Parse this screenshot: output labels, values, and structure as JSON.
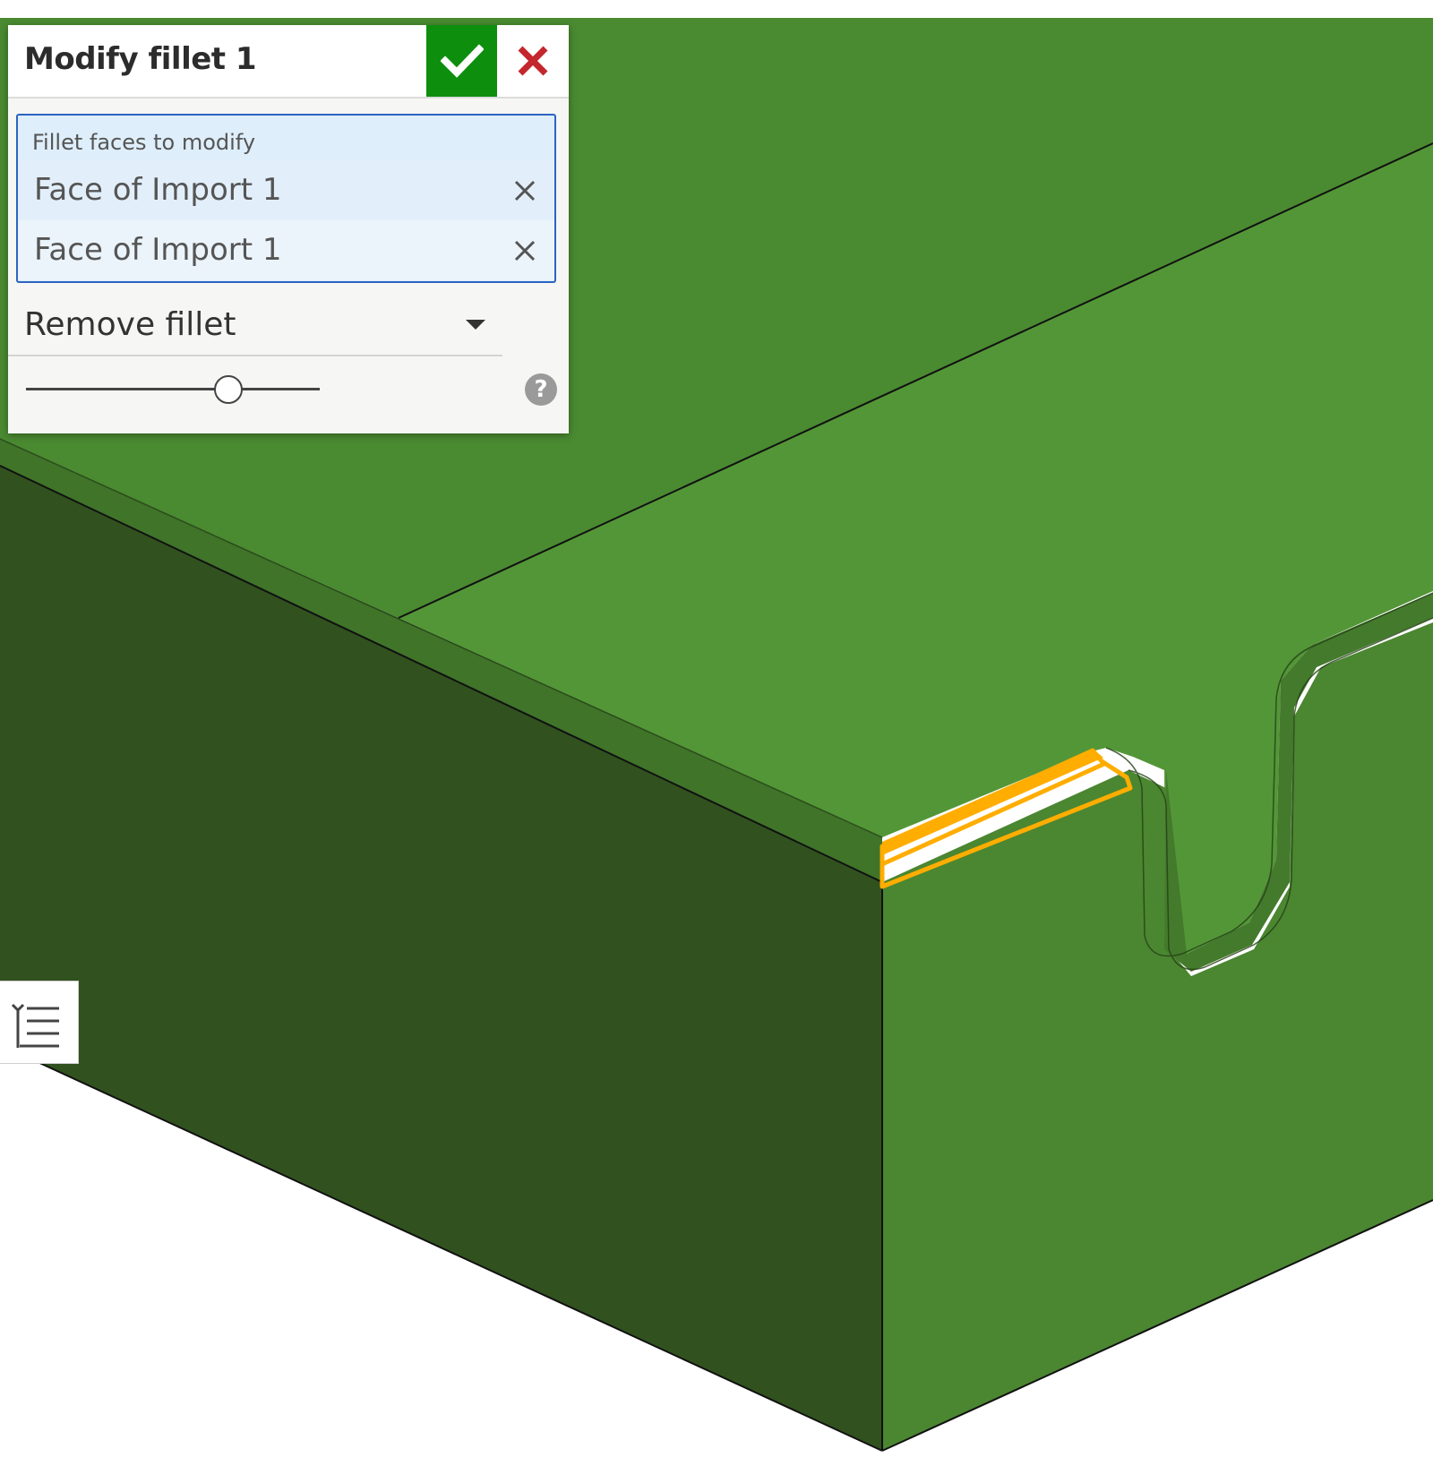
{
  "dialog": {
    "title": "Modify fillet 1",
    "accept_icon": "checkmark-icon",
    "cancel_icon": "close-icon",
    "faces_label": "Fillet faces to modify",
    "faces": [
      {
        "label": "Face of Import 1",
        "remove_icon": "close-icon"
      },
      {
        "label": "Face of Import 1",
        "remove_icon": "close-icon"
      }
    ],
    "mode_selected": "Remove fillet",
    "slider_level": 0.69,
    "help_glyph": "?"
  },
  "viewport": {
    "list_toggle_icon": "feature-list-icon"
  },
  "colors": {
    "accept": "#0d8f0d",
    "cancel": "#c4262e",
    "selection_border": "#2d63c2",
    "highlight": "#ffad00",
    "part_top": "#529a37",
    "part_left": "#31521f",
    "part_right": "#4c8731"
  }
}
